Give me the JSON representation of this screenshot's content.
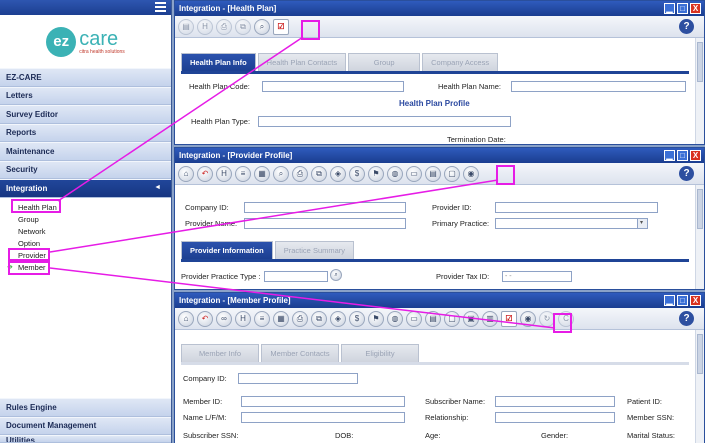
{
  "sidebar": {
    "logo": {
      "mark": "ez",
      "word": "care",
      "tagline": "citra health solutions"
    },
    "nav": [
      {
        "label": "EZ-CARE"
      },
      {
        "label": "Letters"
      },
      {
        "label": "Survey Editor"
      },
      {
        "label": "Reports"
      },
      {
        "label": "Maintenance"
      },
      {
        "label": "Security"
      },
      {
        "label": "Integration",
        "arrow": "◄"
      }
    ],
    "submenu": [
      "Health Plan",
      "Group",
      "Network",
      "Option",
      "Provider",
      "Member"
    ],
    "bottom_nav": [
      {
        "label": "Rules Engine"
      },
      {
        "label": "Document Management"
      },
      {
        "label": "Utilities"
      }
    ]
  },
  "windows": {
    "health_plan": {
      "title": "Integration - [Health Plan]",
      "tabs": [
        "Health Plan Info",
        "Health Plan Contacts",
        "Group",
        "Company Access"
      ],
      "labels": {
        "code": "Health Plan Code:",
        "name": "Health Plan Name:",
        "section": "Health Plan Profile",
        "type": "Health Plan Type:",
        "term": "Termination Date:"
      }
    },
    "provider": {
      "title": "Integration - [Provider Profile]",
      "tabs": [
        "Provider Information",
        "Practice Summary"
      ],
      "labels": {
        "company": "Company ID:",
        "provider_id": "Provider ID:",
        "provider_name": "Provider Name:",
        "primary_practice": "Primary Practice:",
        "practice_type": "Provider Practice Type :",
        "tax_id": "Provider Tax ID:"
      },
      "tax_placeholder": "- -"
    },
    "member": {
      "title": "Integration - [Member Profile]",
      "tabs": [
        "Member Info",
        "Member Contacts",
        "Eligibility"
      ],
      "labels": {
        "company": "Company ID:",
        "member_id": "Member ID:",
        "name": "Name L/F/M:",
        "subscriber_ssn": "Subscriber SSN:",
        "dob": "DOB:",
        "subscriber_name": "Subscriber Name:",
        "relationship": "Relationship:",
        "age": "Age:",
        "gender": "Gender:",
        "patient_id": "Patient ID:",
        "member_ssn": "Member SSN:",
        "marital": "Marital Status:"
      }
    }
  },
  "toolbar": {
    "help": "?",
    "min": "▁",
    "max": "□",
    "close": "X"
  },
  "colors": {
    "highlight": "#e61ce6",
    "titlebar": "#1f4496",
    "accent": "#3bb2b5"
  }
}
